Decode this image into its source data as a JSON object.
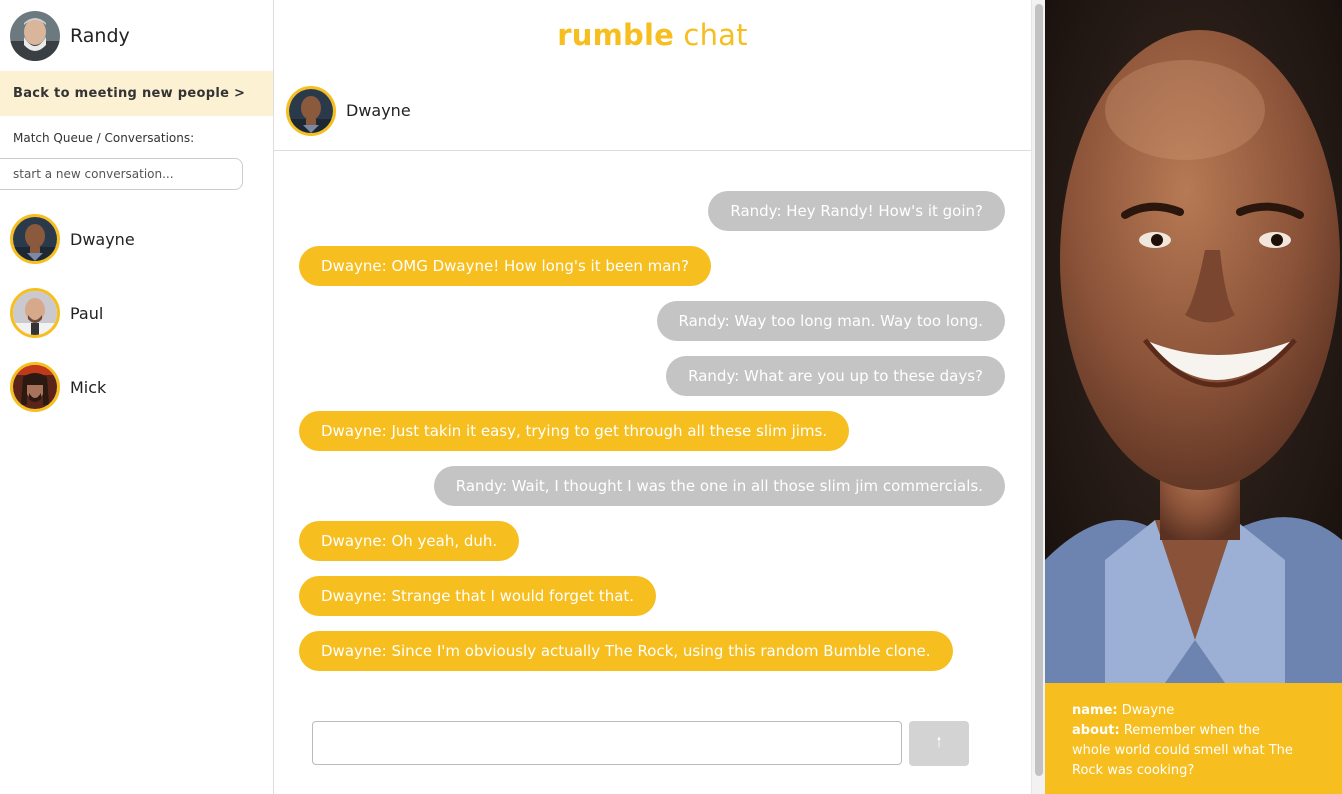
{
  "current_user": {
    "name": "Randy",
    "avatar_icon": "user-avatar-photo"
  },
  "sidebar": {
    "back_link": "Back to meeting new people >",
    "queue_label": "Match Queue / Conversations:",
    "search_placeholder": "start a new conversation...",
    "conversations": [
      {
        "name": "Dwayne"
      },
      {
        "name": "Paul"
      },
      {
        "name": "Mick"
      }
    ]
  },
  "brand": {
    "part1": "rumble",
    "part2": " chat",
    "color": "#f6be1e"
  },
  "chat": {
    "partner_name": "Dwayne",
    "messages": [
      {
        "text": "Randy: Hey Randy! How's it goin?",
        "side": "right"
      },
      {
        "text": "Dwayne: OMG Dwayne! How long's it been man?",
        "side": "left"
      },
      {
        "text": "Randy: Way too long man. Way too long.",
        "side": "right"
      },
      {
        "text": "Randy: What are you up to these days?",
        "side": "right"
      },
      {
        "text": "Dwayne: Just takin it easy, trying to get through all these slim jims.",
        "side": "left"
      },
      {
        "text": "Randy: Wait, I thought I was the one in all those slim jim commercials.",
        "side": "right"
      },
      {
        "text": "Dwayne: Oh yeah, duh.",
        "side": "left"
      },
      {
        "text": "Dwayne: Strange that I would forget that.",
        "side": "left"
      },
      {
        "text": "Dwayne: Since I'm obviously actually The Rock, using this random Bumble clone.",
        "side": "left"
      }
    ],
    "send_icon": "arrow-up-icon",
    "send_glyph": "🠑",
    "composer_value": ""
  },
  "profile": {
    "name_label": "name:",
    "name_value": "Dwayne",
    "about_label": "about:",
    "about_value": "Remember when the whole world could smell what The Rock was cooking?"
  },
  "colors": {
    "accent": "#f6be1e",
    "bubble_gray": "#c4c4c4",
    "highlight": "#fdf1d4"
  }
}
